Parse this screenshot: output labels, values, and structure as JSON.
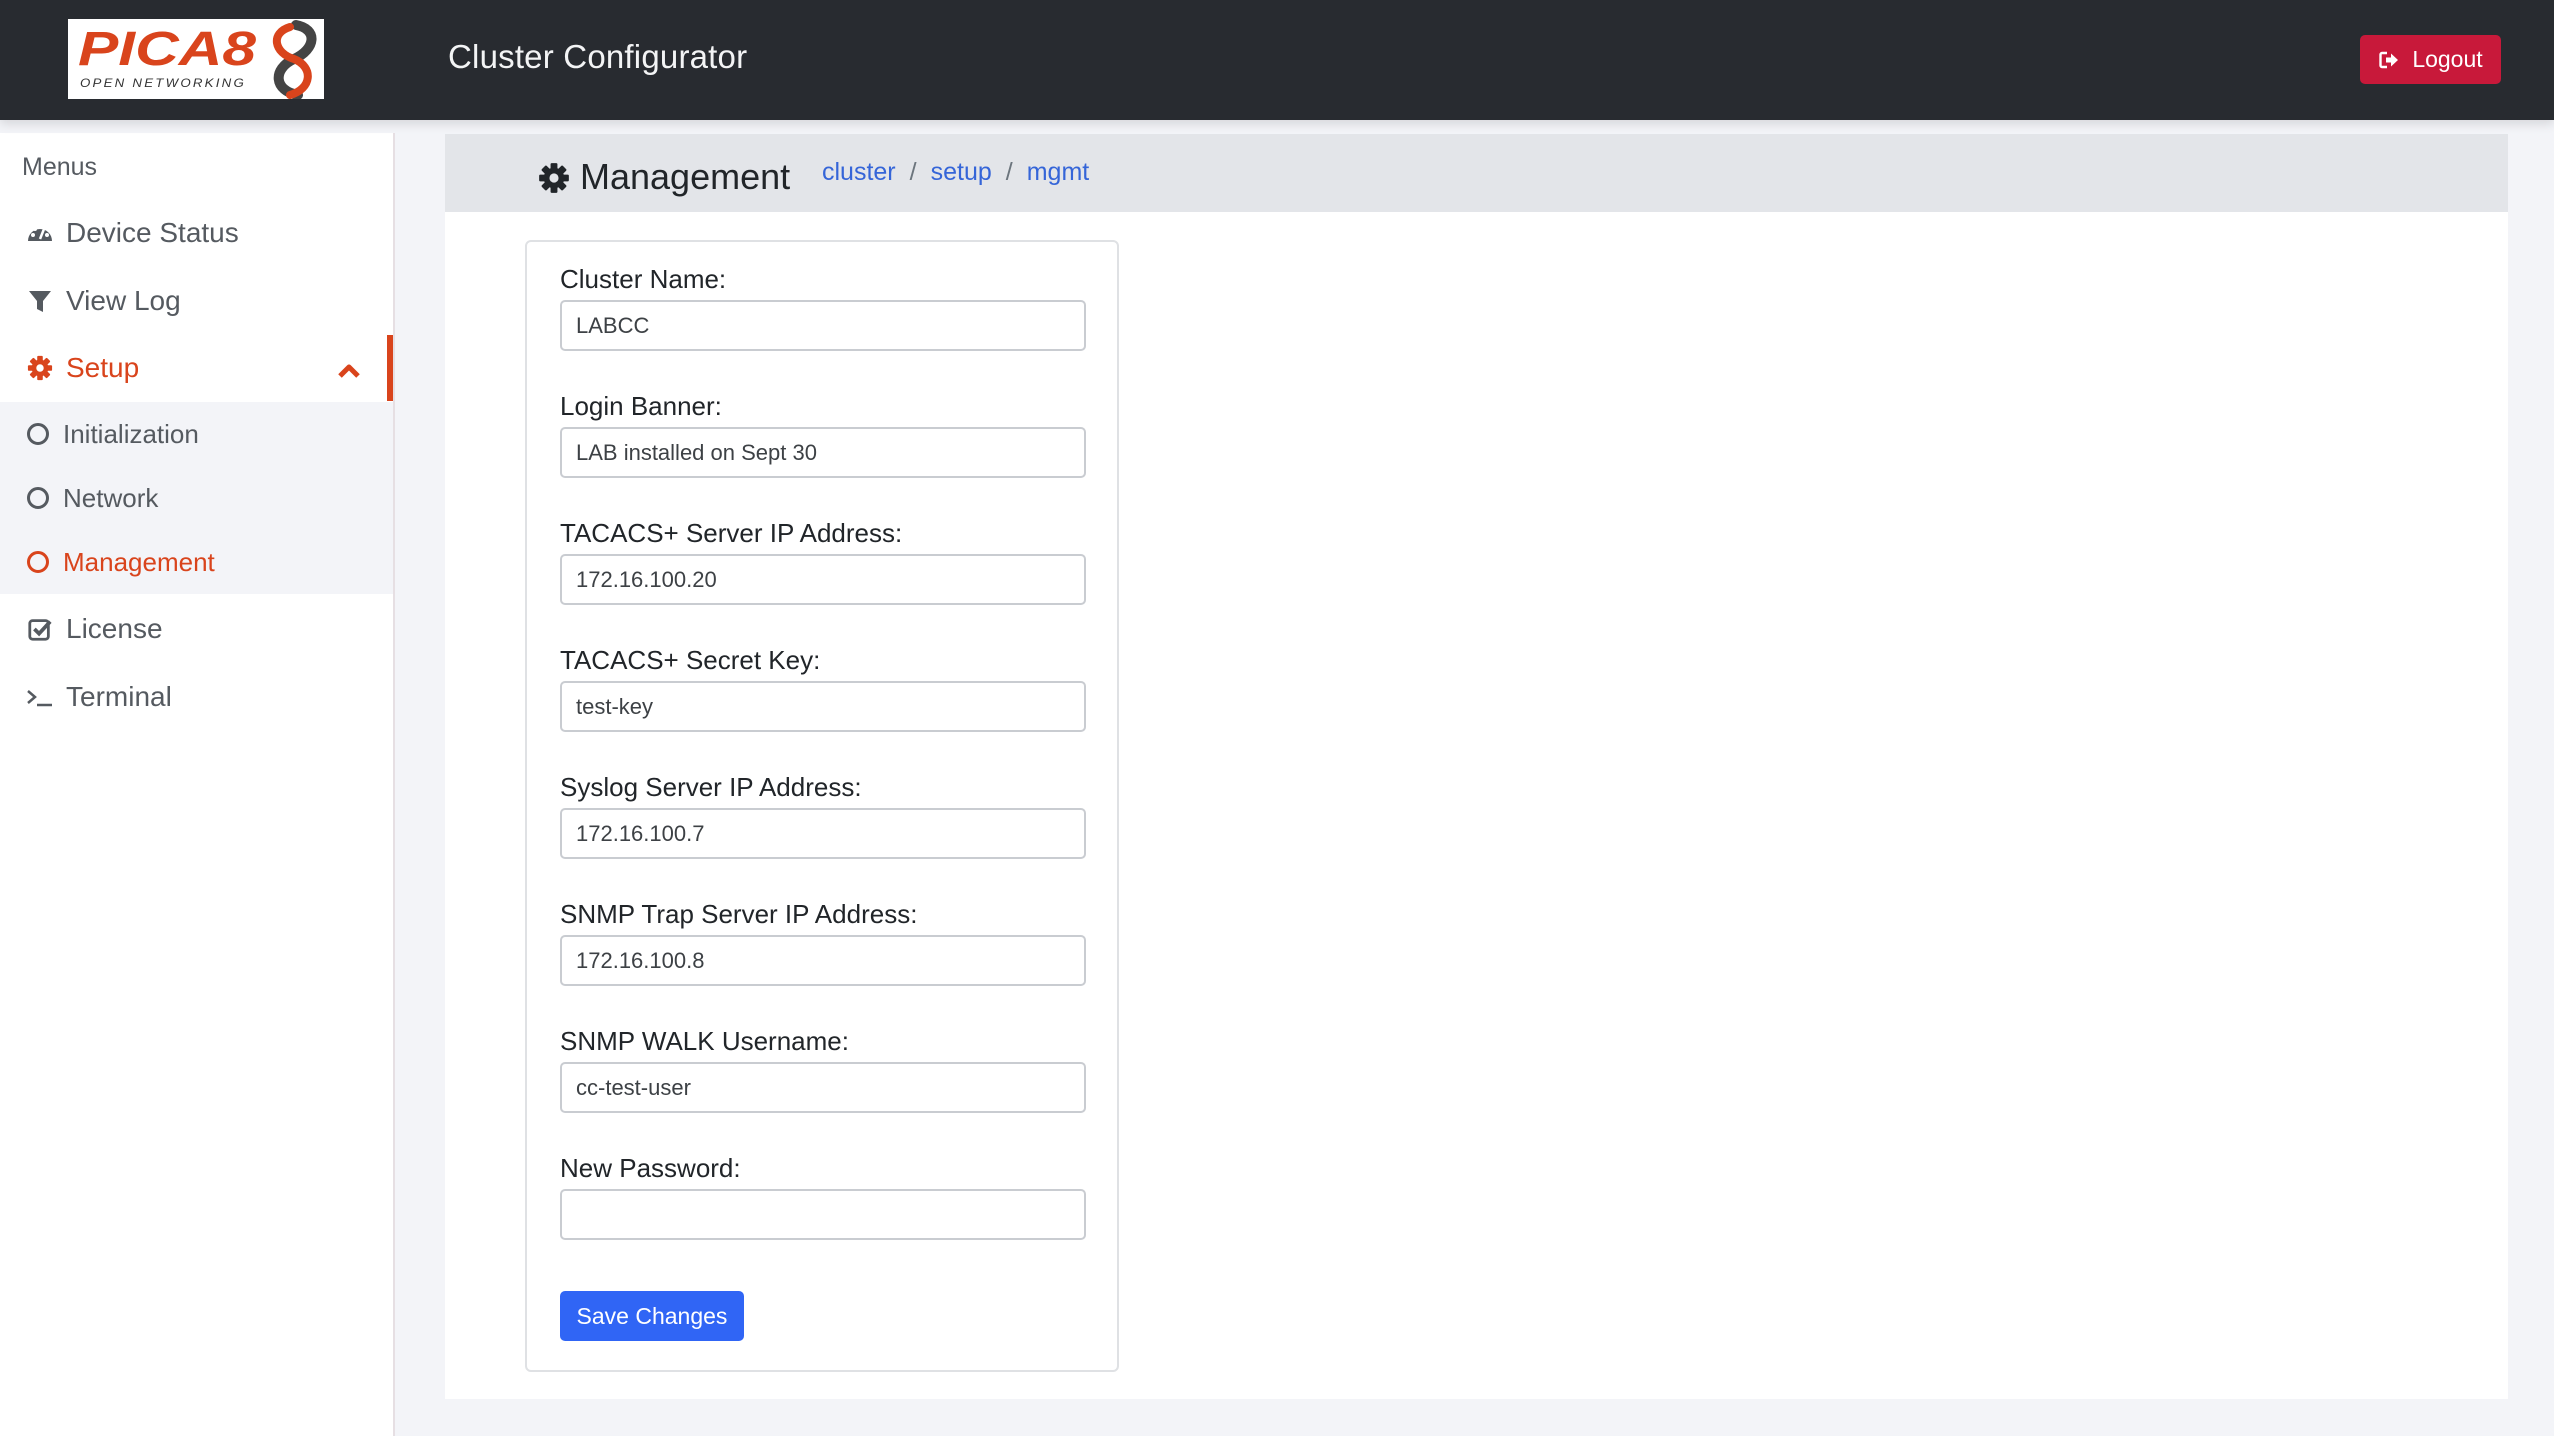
{
  "header": {
    "logo": {
      "brand": "PICA8",
      "tagline": "OPEN NETWORKING"
    },
    "title": "Cluster Configurator",
    "logout_label": "Logout",
    "logout_icon": "sign-out-icon"
  },
  "sidebar": {
    "heading": "Menus",
    "items": [
      {
        "label": "Device Status",
        "icon": "dashboard-icon"
      },
      {
        "label": "View Log",
        "icon": "filter-icon"
      },
      {
        "label": "Setup",
        "icon": "gear-icon",
        "active": true,
        "expanded": true,
        "children": [
          {
            "label": "Initialization",
            "icon": "circle-icon"
          },
          {
            "label": "Network",
            "icon": "circle-icon"
          },
          {
            "label": "Management",
            "icon": "circle-icon",
            "active": true
          }
        ]
      },
      {
        "label": "License",
        "icon": "check-square-icon"
      },
      {
        "label": "Terminal",
        "icon": "terminal-icon"
      }
    ]
  },
  "page": {
    "title": "Management",
    "title_icon": "gear-icon",
    "breadcrumb": [
      "cluster",
      "setup",
      "mgmt"
    ],
    "breadcrumb_separator": "/"
  },
  "form": {
    "fields": [
      {
        "label": "Cluster Name:",
        "value": "LABCC"
      },
      {
        "label": "Login Banner:",
        "value": "LAB installed on Sept 30"
      },
      {
        "label": "TACACS+ Server IP Address:",
        "value": "172.16.100.20"
      },
      {
        "label": "TACACS+ Secret Key:",
        "value": "test-key"
      },
      {
        "label": "Syslog Server IP Address:",
        "value": "172.16.100.7"
      },
      {
        "label": "SNMP Trap Server IP Address:",
        "value": "172.16.100.8"
      },
      {
        "label": "SNMP WALK Username:",
        "value": "cc-test-user"
      },
      {
        "label": "New Password:",
        "value": ""
      }
    ],
    "submit_label": "Save Changes"
  },
  "colors": {
    "header_bg": "#282b30",
    "accent": "#d9441c",
    "logout": "#c8193a",
    "primary": "#3065f5",
    "link": "#3565d8"
  }
}
